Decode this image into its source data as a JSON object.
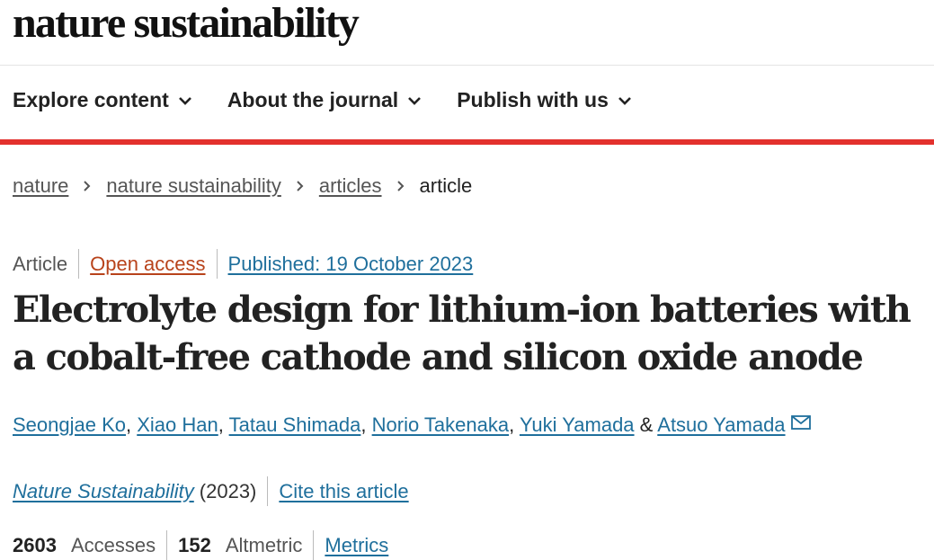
{
  "header": {
    "logo_text": "nature sustainability"
  },
  "nav": {
    "items": [
      {
        "label": "Explore content",
        "icon": "chevron-down-icon"
      },
      {
        "label": "About the journal",
        "icon": "chevron-down-icon"
      },
      {
        "label": "Publish with us",
        "icon": "chevron-down-icon"
      }
    ]
  },
  "colors": {
    "accent_bar": "#e3312d",
    "link": "#1f6f9c",
    "open_access": "#b8431b"
  },
  "breadcrumb": {
    "items": [
      "nature",
      "nature sustainability",
      "articles"
    ],
    "current": "article"
  },
  "article": {
    "type": "Article",
    "access": "Open access",
    "published": "Published: 19 October 2023",
    "title": "Electrolyte design for lithium-ion batteries with a cobalt-free cathode and silicon oxide anode",
    "authors": [
      "Seongjae Ko",
      "Xiao Han",
      "Tatau Shimada",
      "Norio Takenaka",
      "Yuki Yamada",
      "Atsuo Yamada"
    ],
    "author_sep": ",",
    "author_last_sep": "&",
    "contact_icon": "mail-icon",
    "journal": "Nature Sustainability",
    "year": "(2023)",
    "cite_label": "Cite this article"
  },
  "metrics": {
    "accesses_value": "2603",
    "accesses_label": "Accesses",
    "altmetric_value": "152",
    "altmetric_label": "Altmetric",
    "metrics_link": "Metrics"
  }
}
